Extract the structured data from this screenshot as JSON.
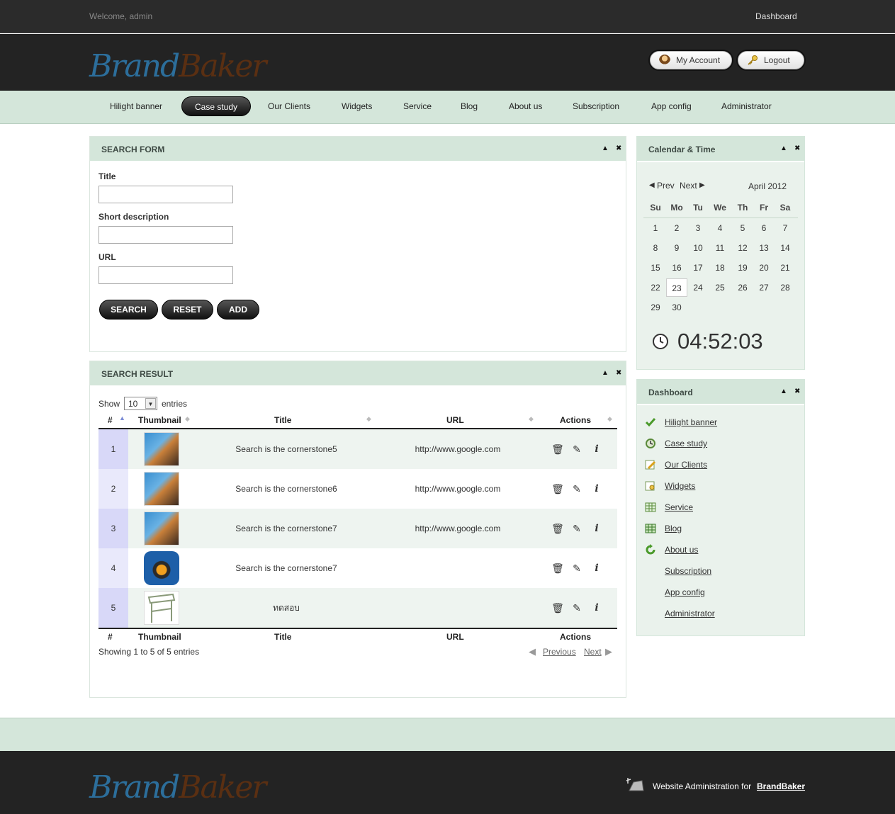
{
  "topbar": {
    "welcome": "Welcome, admin",
    "dashboard_link": "Dashboard"
  },
  "header": {
    "logo_part1": "Brand",
    "logo_part2": "Baker",
    "my_account": "My Account",
    "logout": "Logout"
  },
  "nav": [
    "Hilight banner",
    "Case study",
    "Our Clients",
    "Widgets",
    "Service",
    "Blog",
    "About us",
    "Subscription",
    "App config",
    "Administrator"
  ],
  "nav_active": "Case study",
  "search_form": {
    "title": "SEARCH FORM",
    "fields": [
      {
        "label": "Title",
        "value": ""
      },
      {
        "label": "Short description",
        "value": ""
      },
      {
        "label": "URL",
        "value": ""
      }
    ],
    "buttons": {
      "search": "SEARCH",
      "reset": "RESET",
      "add": "ADD"
    }
  },
  "search_result": {
    "title": "SEARCH RESULT",
    "show_label": "Show",
    "page_size": "10",
    "entries_label": "entries",
    "columns": [
      "#",
      "Thumbnail",
      "Title",
      "URL",
      "Actions"
    ],
    "rows": [
      {
        "num": "1",
        "title": "Search is the cornerstone5",
        "url": "http://www.google.com",
        "thumb": "books-thumbnail"
      },
      {
        "num": "2",
        "title": "Search is the cornerstone6",
        "url": "http://www.google.com",
        "thumb": "books-thumbnail"
      },
      {
        "num": "3",
        "title": "Search is the cornerstone7",
        "url": "http://www.google.com",
        "thumb": "books-thumbnail"
      },
      {
        "num": "4",
        "title": "Search is the cornerstone7",
        "url": "",
        "thumb": "app-icon-thumbnail"
      },
      {
        "num": "5",
        "title": "ทดสอบ",
        "url": "",
        "thumb": "sketch-thumbnail"
      }
    ],
    "info": "Showing 1 to 5 of 5 entries",
    "previous": "Previous",
    "next": "Next"
  },
  "calendar": {
    "title": "Calendar & Time",
    "prev": "Prev",
    "next": "Next",
    "month": "April 2012",
    "weekdays": [
      "Su",
      "Mo",
      "Tu",
      "We",
      "Th",
      "Fr",
      "Sa"
    ],
    "days": [
      [
        "1",
        "2",
        "3",
        "4",
        "5",
        "6",
        "7"
      ],
      [
        "8",
        "9",
        "10",
        "11",
        "12",
        "13",
        "14"
      ],
      [
        "15",
        "16",
        "17",
        "18",
        "19",
        "20",
        "21"
      ],
      [
        "22",
        "23",
        "24",
        "25",
        "26",
        "27",
        "28"
      ],
      [
        "29",
        "30",
        "",
        "",
        "",
        "",
        ""
      ]
    ],
    "today": "23",
    "time": "04:52:03"
  },
  "dashboard": {
    "title": "Dashboard",
    "items": [
      {
        "label": "Hilight banner",
        "icon": "check-icon"
      },
      {
        "label": "Case study",
        "icon": "clock-icon"
      },
      {
        "label": "Our Clients",
        "icon": "edit-note-icon"
      },
      {
        "label": "Widgets",
        "icon": "edit-key-icon"
      },
      {
        "label": "Service",
        "icon": "table-icon"
      },
      {
        "label": "Blog",
        "icon": "grid-icon"
      },
      {
        "label": "About us",
        "icon": "refresh-icon"
      },
      {
        "label": "Subscription",
        "icon": ""
      },
      {
        "label": "App config",
        "icon": ""
      },
      {
        "label": "Administrator",
        "icon": ""
      }
    ]
  },
  "footer": {
    "text": "Website Administration for",
    "brand_link": "BrandBaker"
  }
}
